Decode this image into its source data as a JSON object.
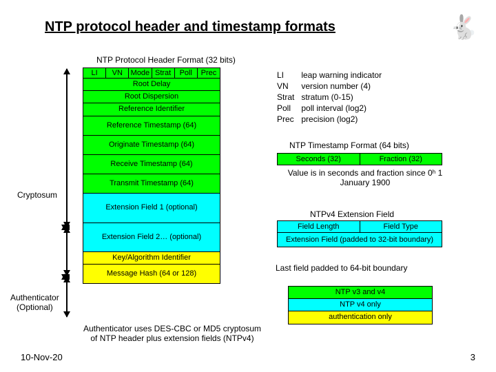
{
  "title": "NTP protocol header and timestamp formats",
  "header_caption": "NTP Protocol Header Format (32 bits)",
  "proto": {
    "row1": [
      "LI",
      "VN",
      "Mode",
      "Strat",
      "Poll",
      "Prec"
    ],
    "root_delay": "Root Delay",
    "root_disp": "Root Dispersion",
    "ref_id": "Reference Identifier",
    "ref_ts": "Reference Timestamp (64)",
    "orig_ts": "Originate Timestamp (64)",
    "recv_ts": "Receive Timestamp (64)",
    "xmit_ts": "Transmit Timestamp (64)",
    "ext1": "Extension Field 1 (optional)",
    "ext2": "Extension Field 2… (optional)",
    "key_alg": "Key/Algorithm Identifier",
    "hash": "Message Hash (64 or 128)"
  },
  "labels": {
    "cryptosum": "Cryptosum",
    "auth1": "Authenticator",
    "auth2": "(Optional)"
  },
  "defs": [
    [
      "LI",
      "leap warning indicator"
    ],
    [
      "VN",
      "version number (4)"
    ],
    [
      "Strat",
      "stratum (0-15)"
    ],
    [
      "Poll",
      "poll interval (log2)"
    ],
    [
      "Prec",
      "precision (log2)"
    ]
  ],
  "ts_caption": "NTP Timestamp Format (64 bits)",
  "ts_fields": [
    "Seconds (32)",
    "Fraction (32)"
  ],
  "ts_note": "Value is in seconds and fraction since 0ʰ 1 January 1900",
  "ext_caption": "NTPv4 Extension Field",
  "ext_fields": [
    "Field Length",
    "Field Type"
  ],
  "ext_body": "Extension Field (padded to 32-bit boundary)",
  "ext_note": "Last field padded to 64-bit boundary",
  "ver": [
    "NTP v3 and v4",
    "NTP v4 only",
    "authentication only"
  ],
  "auth_note": "Authenticator uses DES-CBC or MD5 cryptosum of NTP header plus extension fields (NTPv4)",
  "date": "10-Nov-20",
  "page": "3",
  "rabbit": "🐇"
}
